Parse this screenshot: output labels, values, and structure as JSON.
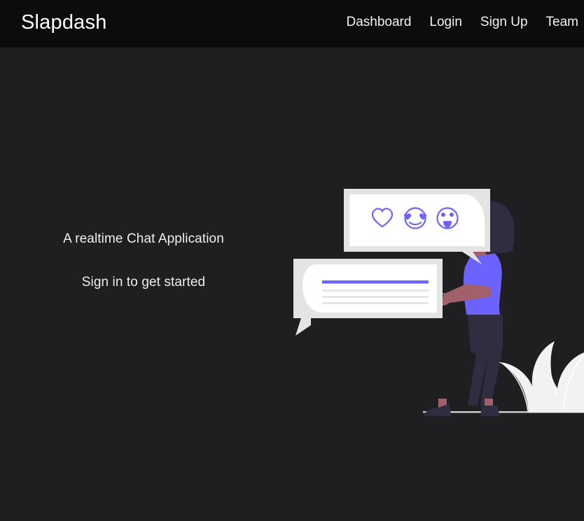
{
  "page": {
    "background_color": "#1f1f21",
    "accent_color": "#6c63ff"
  },
  "navbar": {
    "background_color": "#0c0c0d",
    "brand": "Slapdash",
    "links": [
      {
        "label": "Dashboard",
        "name": "nav-link-dashboard"
      },
      {
        "label": "Login",
        "name": "nav-link-login"
      },
      {
        "label": "Sign Up",
        "name": "nav-link-signup"
      },
      {
        "label": "Team",
        "name": "nav-link-team"
      }
    ]
  },
  "hero": {
    "title": "A realtime Chat Application",
    "subtitle": "Sign in to get started"
  },
  "illustration": {
    "name": "chat-illustration",
    "reaction_bubble": {
      "name": "reaction-speech-bubble",
      "reactions": [
        {
          "name": "heart-icon",
          "label": "heart"
        },
        {
          "name": "heart-eyes-face-icon",
          "label": "heart-eyes"
        },
        {
          "name": "surprised-face-icon",
          "label": "surprised"
        }
      ]
    },
    "message_bubble": {
      "name": "message-speech-bubble",
      "lines": [
        {
          "name": "message-line-highlight",
          "color": "#6c63ff"
        },
        {
          "name": "message-line-1",
          "color": "#e6e6e6"
        },
        {
          "name": "message-line-2",
          "color": "#e6e6e6"
        },
        {
          "name": "message-line-3",
          "color": "#e6e6e6"
        }
      ]
    },
    "person": {
      "name": "walking-person-figure",
      "hair_color": "#2f2e41",
      "shirt_color": "#6c63ff",
      "trousers_color": "#2f2e41",
      "skin_color": "#a0616a",
      "shoes_color": "#2f2e41"
    },
    "plant": {
      "name": "plant-leaves",
      "color": "#f2f2f2"
    },
    "ground": {
      "name": "ground-line",
      "color": "#d0d0d0"
    }
  }
}
